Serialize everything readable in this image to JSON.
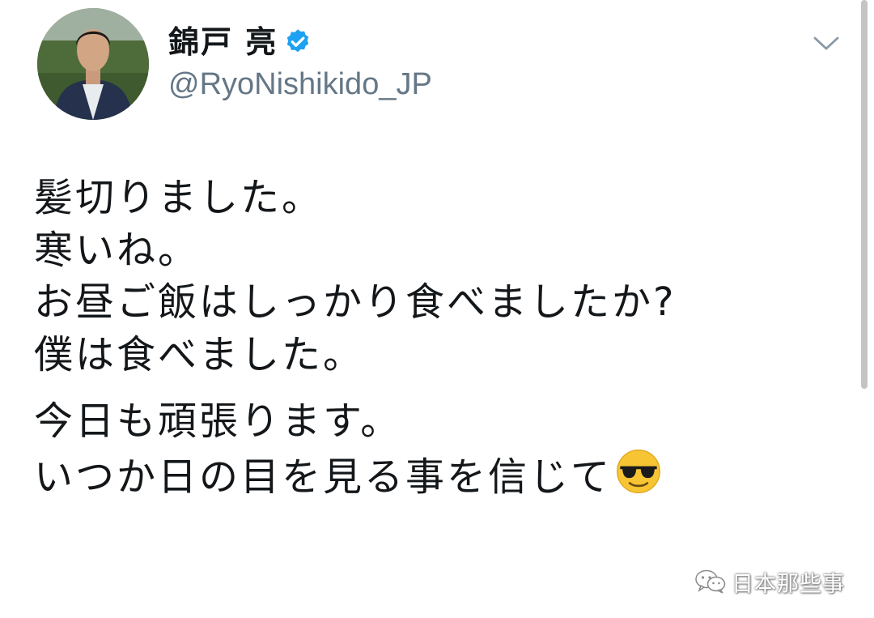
{
  "user": {
    "display_name": "錦戸 亮",
    "handle": "@RyoNishikido_JP",
    "verified": true
  },
  "tweet": {
    "lines": [
      "髪切りました。",
      "寒いね。",
      "お昼ご飯はしっかり食べましたか?",
      "僕は食べました。",
      "今日も頑張ります。",
      "いつか日の目を見る事を信じて"
    ],
    "trailing_emoji": "smiling-face-with-sunglasses"
  },
  "watermark": {
    "text": "日本那些事"
  },
  "icons": {
    "verified": "verified-badge-icon",
    "menu": "chevron-down-icon"
  },
  "colors": {
    "text": "#14171a",
    "handle": "#657786",
    "verified": "#1da1f2"
  }
}
